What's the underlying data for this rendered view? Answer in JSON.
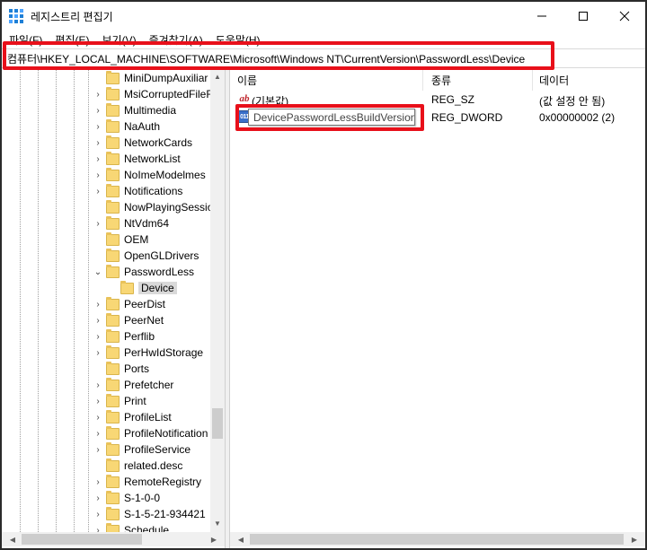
{
  "window": {
    "title": "레지스트리 편집기",
    "controls": {
      "minimize": "minimize-icon",
      "maximize": "maximize-icon",
      "close": "close-icon"
    }
  },
  "menu": {
    "items": [
      "파일(F)",
      "편집(E)",
      "보기(V)",
      "즐겨찾기(A)",
      "도움말(H)"
    ]
  },
  "address": {
    "path": "컴퓨터\\HKEY_LOCAL_MACHINE\\SOFTWARE\\Microsoft\\Windows NT\\CurrentVersion\\PasswordLess\\Device"
  },
  "tree": {
    "items": [
      {
        "label": "MiniDumpAuxiliar",
        "expander": ""
      },
      {
        "label": "MsiCorruptedFileR",
        "expander": "›"
      },
      {
        "label": "Multimedia",
        "expander": "›"
      },
      {
        "label": "NaAuth",
        "expander": "›"
      },
      {
        "label": "NetworkCards",
        "expander": "›"
      },
      {
        "label": "NetworkList",
        "expander": "›"
      },
      {
        "label": "NoImeModelmes",
        "expander": "›"
      },
      {
        "label": "Notifications",
        "expander": "›"
      },
      {
        "label": "NowPlayingSessio",
        "expander": ""
      },
      {
        "label": "NtVdm64",
        "expander": "›"
      },
      {
        "label": "OEM",
        "expander": ""
      },
      {
        "label": "OpenGLDrivers",
        "expander": ""
      },
      {
        "label": "PasswordLess",
        "expander": "⌄"
      },
      {
        "label": "Device",
        "expander": "",
        "child": true,
        "selected": true
      },
      {
        "label": "PeerDist",
        "expander": "›"
      },
      {
        "label": "PeerNet",
        "expander": "›"
      },
      {
        "label": "Perflib",
        "expander": "›"
      },
      {
        "label": "PerHwIdStorage",
        "expander": "›"
      },
      {
        "label": "Ports",
        "expander": ""
      },
      {
        "label": "Prefetcher",
        "expander": "›"
      },
      {
        "label": "Print",
        "expander": "›"
      },
      {
        "label": "ProfileList",
        "expander": "›"
      },
      {
        "label": "ProfileNotification",
        "expander": "›"
      },
      {
        "label": "ProfileService",
        "expander": "›"
      },
      {
        "label": "related.desc",
        "expander": ""
      },
      {
        "label": "RemoteRegistry",
        "expander": "›"
      },
      {
        "label": "S-1-0-0",
        "expander": "›"
      },
      {
        "label": "S-1-5-21-934421",
        "expander": "›"
      },
      {
        "label": "Schedule",
        "expander": "›"
      }
    ]
  },
  "list": {
    "columns": [
      "이름",
      "종류",
      "데이터"
    ],
    "rows": [
      {
        "icon": "string-value-icon",
        "icon_text": "ab",
        "name": "(기본값)",
        "type": "REG_SZ",
        "data": "(값 설정 안 됨)"
      },
      {
        "icon": "dword-value-icon",
        "icon_text": "011",
        "name": "DevicePasswordLessBuildVersion",
        "type": "REG_DWORD",
        "data": "0x00000002 (2)",
        "editing": true
      }
    ]
  },
  "colors": {
    "highlight": "#e8101a",
    "folder": "#f8d775",
    "selection": "#d9d9d9"
  }
}
